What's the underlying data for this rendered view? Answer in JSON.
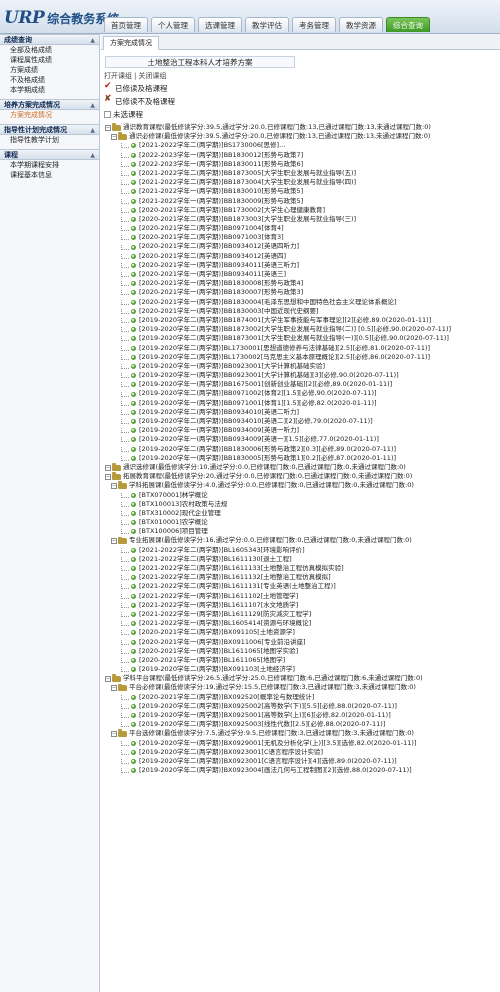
{
  "header": {
    "logo_en": "URP",
    "logo_cn": "综合教务系统",
    "tabs": [
      {
        "label": "首页管理"
      },
      {
        "label": "个人管理"
      },
      {
        "label": "选课管理"
      },
      {
        "label": "教学评估"
      },
      {
        "label": "考务管理"
      },
      {
        "label": "教学资源"
      },
      {
        "label": "综合查询"
      }
    ]
  },
  "sidebar": {
    "sections": [
      {
        "title": "成绩查询",
        "items": [
          "全部及格成绩",
          "课程属性成绩",
          "方案成绩",
          "不及格成绩",
          "本学期成绩"
        ]
      },
      {
        "title": "培养方案完成情况",
        "items": [
          "方案完成情况"
        ]
      },
      {
        "title": "指导性计划完成情况",
        "items": [
          "指导性教学计划"
        ]
      },
      {
        "title": "课程",
        "items": [
          "本学期课程安排",
          "课程基本信息"
        ]
      }
    ]
  },
  "main": {
    "tab_title": "方案完成情况",
    "plan_title": "土地整治工程本科人才培养方案",
    "toolbar": {
      "expand": "打开课组",
      "sep": "|",
      "collapse": "关闭课组"
    },
    "legend": [
      "已修读及格课程",
      "已修读不及格课程",
      "未选课程"
    ],
    "tree": [
      {
        "lvl": 0,
        "t": "f",
        "text": "通识教育课程(最低修读学分:39.5,通过学分:20.0,已修课程门数:13,已通过课程门数:13,未通过课程门数:0)"
      },
      {
        "lvl": 1,
        "t": "f",
        "text": "通识必修课(最低修读学分:39.5,通过学分:20.0,已修课程门数:13,已通过课程门数:13,未通过课程门数:0)"
      },
      {
        "lvl": 2,
        "t": "l",
        "text": "[2021-2022学年二(两学期)]BS1730006[思修]..."
      },
      {
        "lvl": 2,
        "t": "l",
        "text": "[2022-2023学年一(两学期)]BB1830012[形势与政策7]"
      },
      {
        "lvl": 2,
        "t": "l",
        "text": "[2022-2023学年一(两学期)]BB1830011[形势与政策6]"
      },
      {
        "lvl": 2,
        "t": "l",
        "text": "[2021-2022学年二(两学期)]BB1873005[大学生职业发展与就业指导(五)]"
      },
      {
        "lvl": 2,
        "t": "l",
        "text": "[2021-2022学年二(两学期)]BB1873004[大学生职业发展与就业指导(四)]"
      },
      {
        "lvl": 2,
        "t": "l",
        "text": "[2021-2022学年一(两学期)]BB1830010[形势与政策5]"
      },
      {
        "lvl": 2,
        "t": "l",
        "text": "[2021-2022学年一(两学期)]BB1830009[形势与政策5]"
      },
      {
        "lvl": 2,
        "t": "l",
        "text": "[2020-2021学年二(两学期)]BB1730002[大学生心理健康教育]"
      },
      {
        "lvl": 2,
        "t": "l",
        "text": "[2020-2021学年二(两学期)]BB1873003[大学生职业发展与就业指导(三)]"
      },
      {
        "lvl": 2,
        "t": "l",
        "text": "[2020-2021学年二(两学期)]BB0971004[体育4]"
      },
      {
        "lvl": 2,
        "t": "l",
        "text": "[2020-2021学年二(两学期)]BB0971003[体育3]"
      },
      {
        "lvl": 2,
        "t": "l",
        "text": "[2020-2021学年二(两学期)]BB0934012[英语四听力]"
      },
      {
        "lvl": 2,
        "t": "l",
        "text": "[2020-2021学年二(两学期)]BB0934012[英语四]"
      },
      {
        "lvl": 2,
        "t": "l",
        "text": "[2020-2021学年一(两学期)]BB0934011[英语三听力]"
      },
      {
        "lvl": 2,
        "t": "l",
        "text": "[2020-2021学年一(两学期)]BB0934011[英语三]"
      },
      {
        "lvl": 2,
        "t": "l",
        "text": "[2020-2021学年一(两学期)]BB1830008[形势与政策4]"
      },
      {
        "lvl": 2,
        "t": "l",
        "text": "[2020-2021学年一(两学期)]BB1830007[形势与政策3]"
      },
      {
        "lvl": 2,
        "t": "l",
        "text": "[2020-2021学年一(两学期)]BB1830004[毛泽东思想和中国特色社会主义理论体系概论]"
      },
      {
        "lvl": 2,
        "t": "l",
        "text": "[2020-2021学年一(两学期)]BB1830003[中国近现代史纲要]"
      },
      {
        "lvl": 2,
        "t": "l",
        "text": "[2019-2020学年二(两学期)]BB1874001[大学生军事技能与军事理论][2][必修,89.0(2020-01-11)]"
      },
      {
        "lvl": 2,
        "t": "l",
        "text": "[2019-2020学年二(两学期)]BB1873002[大学生职业发展与就业指导(二)] [0.5][必修,90.0(2020-07-11)]"
      },
      {
        "lvl": 2,
        "t": "l",
        "text": "[2019-2020学年二(两学期)]BB1873001[大学生职业发展与就业指导(一)][0.5][必修,90.0(2020-07-11)]"
      },
      {
        "lvl": 2,
        "t": "l",
        "text": "[2019-2020学年二(两学期)]BL1730001[思想道德修养与法律基础][2.5][必修,81.0(2020-07-11)]"
      },
      {
        "lvl": 2,
        "t": "l",
        "text": "[2019-2020学年二(两学期)]BL1730002[马克思主义基本原理概论][2.5][必修,86.0(2020-07-11)]"
      },
      {
        "lvl": 2,
        "t": "l",
        "text": "[2019-2020学年一(两学期)]BB0923001[大学计算机基础实验]"
      },
      {
        "lvl": 2,
        "t": "l",
        "text": "[2019-2020学年一(两学期)]BB0923001[大学计算机基础][3][必修,90.0(2020-07-11)]"
      },
      {
        "lvl": 2,
        "t": "l",
        "text": "[2019-2020学年一(两学期)]BB1675001[创新创业基础][2][必修,89.0(2020-01-11)]"
      },
      {
        "lvl": 2,
        "t": "l",
        "text": "[2019-2020学年二(两学期)]BB0971002[体育2][1.5][必修,90.0(2020-07-11)]"
      },
      {
        "lvl": 2,
        "t": "l",
        "text": "[2019-2020学年一(两学期)]BB0971001[体育1][1.5][必修,82.0(2020-01-11)]"
      },
      {
        "lvl": 2,
        "t": "l",
        "text": "[2019-2020学年二(两学期)]BB0934010[英语二听力]"
      },
      {
        "lvl": 2,
        "t": "l",
        "text": "[2019-2020学年二(两学期)]BB0934010[英语二][2][必修,79.0(2020-07-11)]"
      },
      {
        "lvl": 2,
        "t": "l",
        "text": "[2019-2020学年一(两学期)]BB0934009[英语一听力]"
      },
      {
        "lvl": 2,
        "t": "l",
        "text": "[2019-2020学年一(两学期)]BB0934009[英语一][1.5][必修,77.0(2020-01-11)]"
      },
      {
        "lvl": 2,
        "t": "l",
        "text": "[2019-2020学年二(两学期)]BB1830006[形势与政策2][0.3][必修,89.0(2020-07-11)]"
      },
      {
        "lvl": 2,
        "t": "l",
        "text": "[2019-2020学年一(两学期)]BB1830005[形势与政策1][0.2][必修,87.0(2020-01-11)]"
      },
      {
        "lvl": 0,
        "t": "f",
        "text": "通识选修课(最低修读学分:10,通过学分:0.0,已修课程门数:0,已通过课程门数:0,未通过课程门数:0)"
      },
      {
        "lvl": 0,
        "t": "f",
        "text": "拓展教育课程(最低修读学分:20,通过学分:0.0,已修课程门数:0,已通过课程门数:0,未通过课程门数:0)"
      },
      {
        "lvl": 1,
        "t": "f",
        "text": "学科拓展课(最低修读学分:4.0,通过学分:0.0,已修课程门数:0,已通过课程门数:0,未通过课程门数:0)"
      },
      {
        "lvl": 2,
        "t": "l",
        "text": "[BTX070001]林学概论"
      },
      {
        "lvl": 2,
        "t": "l",
        "text": "[BTX100013]农村政策与法规"
      },
      {
        "lvl": 2,
        "t": "l",
        "text": "[BTX310002]现代企业管理"
      },
      {
        "lvl": 2,
        "t": "l",
        "text": "[BTX010001]农学概论"
      },
      {
        "lvl": 2,
        "t": "l",
        "text": "[BTX100006]项目管理"
      },
      {
        "lvl": 1,
        "t": "f",
        "text": "专业拓展课(最低修读学分:16,通过学分:0.0,已修课程门数:0,已通过课程门数:0,未通过课程门数:0)"
      },
      {
        "lvl": 2,
        "t": "l",
        "text": "[2021-2022学年二(两学期)]BL1605343[环境影响评价]"
      },
      {
        "lvl": 2,
        "t": "l",
        "text": "[2021-2022学年二(两学期)]BL1611130[退土工程]"
      },
      {
        "lvl": 2,
        "t": "l",
        "text": "[2021-2022学年二(两学期)]BL1611133[土地整治工程仿真模拟实验]"
      },
      {
        "lvl": 2,
        "t": "l",
        "text": "[2021-2022学年二(两学期)]BL1611132[土地整治工程仿真模拟]"
      },
      {
        "lvl": 2,
        "t": "l",
        "text": "[2021-2022学年二(两学期)]BL1611131[专业英语(土地整治工程)]"
      },
      {
        "lvl": 2,
        "t": "l",
        "text": "[2021-2022学年一(两学期)]BL1611102[土地管理学]"
      },
      {
        "lvl": 2,
        "t": "l",
        "text": "[2021-2022学年一(两学期)]BL1611107[水文地质学]"
      },
      {
        "lvl": 2,
        "t": "l",
        "text": "[2021-2022学年一(两学期)]BL1611129[防灾减灾工程学]"
      },
      {
        "lvl": 2,
        "t": "l",
        "text": "[2021-2022学年一(两学期)]BL1605414[资源与环境概论]"
      },
      {
        "lvl": 2,
        "t": "l",
        "text": "[2020-2021学年二(两学期)]BX091105[土地资源学]"
      },
      {
        "lvl": 2,
        "t": "l",
        "text": "[2020-2021学年一(两学期)]BX0911006[专业前沿讲座]"
      },
      {
        "lvl": 2,
        "t": "l",
        "text": "[2020-2021学年一(两学期)]BL1611065[地图学实验]"
      },
      {
        "lvl": 2,
        "t": "l",
        "text": "[2020-2021学年一(两学期)]BL1611065[地图学]"
      },
      {
        "lvl": 2,
        "t": "l",
        "text": "[2019-2020学年二(两学期)]BX091103[土地经济学]"
      },
      {
        "lvl": 0,
        "t": "f",
        "text": "学科平台课程(最低修读学分:26.5,通过学分:25.0,已修课程门数:6,已通过课程门数:6,未通过课程门数:0)"
      },
      {
        "lvl": 1,
        "t": "f",
        "text": "平台必修课(最低修读学分:19,通过学分:15.5,已修课程门数:3,已通过课程门数:3,未通过课程门数:0)"
      },
      {
        "lvl": 2,
        "t": "l",
        "text": "[2020-2021学年二(两学期)]BX092520[概率论与数理统计]"
      },
      {
        "lvl": 2,
        "t": "l",
        "text": "[2019-2020学年二(两学期)]BX0925002[高等数学(下)][5.5][必修,88.0(2020-07-11)]"
      },
      {
        "lvl": 2,
        "t": "l",
        "text": "[2019-2020学年一(两学期)]BX0925001[高等数学(上)][6][必修,82.0(2020-01-11)]"
      },
      {
        "lvl": 2,
        "t": "l",
        "text": "[2019-2020学年二(两学期)]BX0925003[线性代数][2.5][必修,88.0(2020-07-11)]"
      },
      {
        "lvl": 1,
        "t": "f",
        "text": "平台选修课(最低修读学分:7.5,通过学分:9.5,已修课程门数:3,已通过课程门数:3,未通过课程门数:0)"
      },
      {
        "lvl": 2,
        "t": "l",
        "text": "[2019-2020学年一(两学期)]BX0929001[无机及分析化学(上)][3.5][选修,82.0(2020-01-11)]"
      },
      {
        "lvl": 2,
        "t": "l",
        "text": "[2019-2020学年二(两学期)]BX0923001[C语言程序设计实验]"
      },
      {
        "lvl": 2,
        "t": "l",
        "text": "[2019-2020学年二(两学期)]BX0923001[C语言程序设计][4][选修,89.0(2020-07-11)]"
      },
      {
        "lvl": 2,
        "t": "l",
        "text": "[2019-2020学年二(两学期)]BX0923004[画法几何与工程制图][2][选修,88.0(2020-07-11)]"
      }
    ]
  }
}
